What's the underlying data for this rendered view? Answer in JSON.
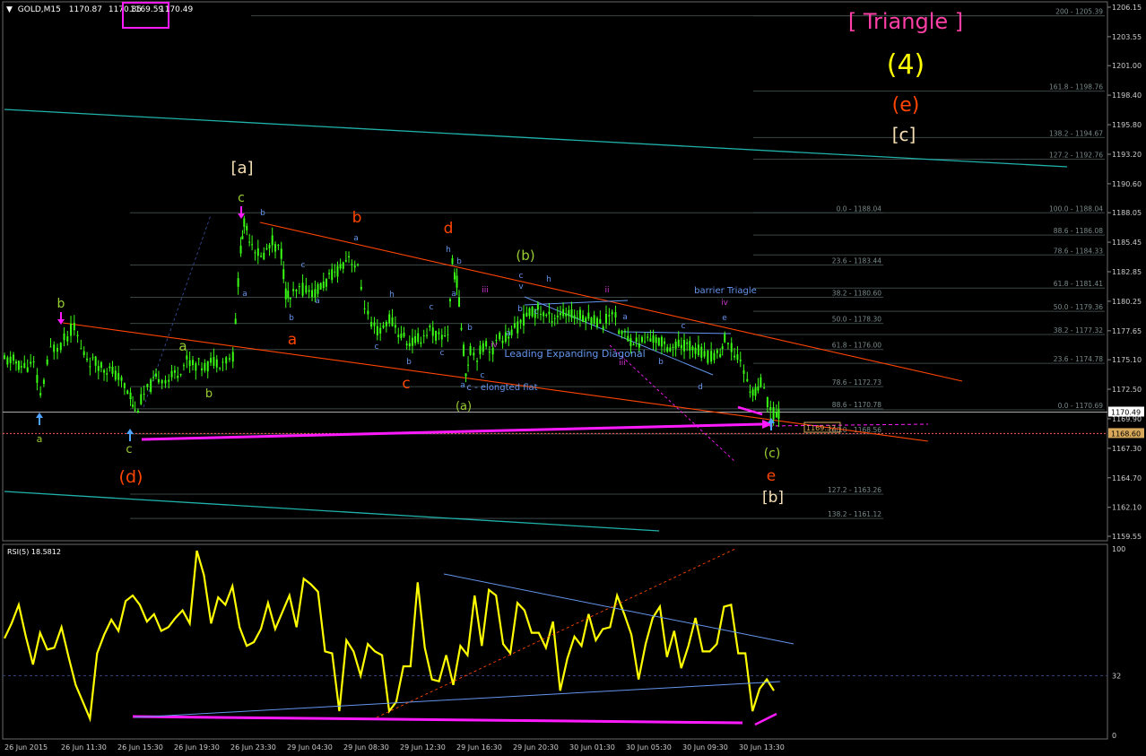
{
  "header": {
    "symbol": "GOLD,M15",
    "open": "1170.87",
    "high": "1170.85",
    "low": "1169.59",
    "close": "1170.49"
  },
  "colors": {
    "background": "#000000",
    "candle": "#39ff14",
    "trendline": "#ff4500",
    "teal": "#20b2aa",
    "magenta": "#ff1aff",
    "rsi": "#ffff00",
    "fib": "#7a8a8a",
    "triangle_title": "#ff3fa6",
    "wave_yellow": "#ffff00",
    "wave_red": "#ff4500",
    "wave_white": "#f5deb3",
    "wave_olive": "#9acd32",
    "wave_blue": "#6495ed",
    "wave_purple": "#cc33cc"
  },
  "chart_data": [
    {
      "type": "candlestick",
      "symbol": "GOLD",
      "timeframe": "M15",
      "ylim": [
        1159.55,
        1206.15
      ],
      "y_ticks": [
        "1206.15",
        "1203.55",
        "1201.00",
        "1198.40",
        "1195.80",
        "1193.20",
        "1190.60",
        "1188.05",
        "1185.45",
        "1182.85",
        "1180.25",
        "1177.65",
        "1175.10",
        "1172.50",
        "1169.90",
        "1167.30",
        "1164.70",
        "1162.10",
        "1159.55"
      ],
      "x_ticks": [
        "26 Jun 2015",
        "26 Jun 11:30",
        "26 Jun 15:30",
        "26 Jun 19:30",
        "26 Jun 23:30",
        "29 Jun 04:30",
        "29 Jun 08:30",
        "29 Jun 12:30",
        "29 Jun 16:30",
        "29 Jun 20:30",
        "30 Jun 01:30",
        "30 Jun 05:30",
        "30 Jun 09:30",
        "30 Jun 13:30"
      ],
      "price_badges": {
        "current": "1170.49",
        "level": "1168.60",
        "marker": "1169.32"
      },
      "price_path": [
        [
          0.0,
          1175.0
        ],
        [
          0.8,
          1175.0
        ],
        [
          1.5,
          1174.5
        ],
        [
          2.6,
          1174.6
        ],
        [
          3.2,
          1172.0
        ],
        [
          4.1,
          1176.0
        ],
        [
          5.0,
          1176.5
        ],
        [
          5.6,
          1177.2
        ],
        [
          6.2,
          1178.2
        ],
        [
          6.8,
          1176.0
        ],
        [
          7.6,
          1175.0
        ],
        [
          8.6,
          1174.6
        ],
        [
          9.6,
          1174.0
        ],
        [
          10.4,
          1173.2
        ],
        [
          11.2,
          1172.0
        ],
        [
          11.6,
          1170.5
        ],
        [
          12.4,
          1172.0
        ],
        [
          13.0,
          1172.8
        ],
        [
          13.7,
          1173.6
        ],
        [
          14.6,
          1173.4
        ],
        [
          15.4,
          1174.0
        ],
        [
          16.2,
          1175.0
        ],
        [
          17.0,
          1174.7
        ],
        [
          17.8,
          1174.5
        ],
        [
          18.6,
          1175.0
        ],
        [
          19.4,
          1175.0
        ],
        [
          20.3,
          1175.4
        ],
        [
          21.0,
          1185.0
        ],
        [
          21.3,
          1187.0
        ],
        [
          22.0,
          1185.5
        ],
        [
          22.8,
          1184.0
        ],
        [
          23.8,
          1185.5
        ],
        [
          24.6,
          1184.5
        ],
        [
          25.0,
          1181.0
        ],
        [
          25.4,
          1180.5
        ],
        [
          26.2,
          1181.2
        ],
        [
          26.8,
          1181.4
        ],
        [
          27.6,
          1181.0
        ],
        [
          28.6,
          1182.0
        ],
        [
          29.6,
          1183.0
        ],
        [
          30.6,
          1184.3
        ],
        [
          31.4,
          1183.0
        ],
        [
          32.0,
          1180.0
        ],
        [
          32.6,
          1178.0
        ],
        [
          33.4,
          1177.5
        ],
        [
          34.2,
          1178.8
        ],
        [
          35.0,
          1177.5
        ],
        [
          36.0,
          1176.5
        ],
        [
          37.0,
          1177.0
        ],
        [
          37.8,
          1177.8
        ],
        [
          38.6,
          1177.0
        ],
        [
          39.4,
          1177.5
        ],
        [
          39.8,
          1183.5
        ],
        [
          40.2,
          1182.0
        ],
        [
          40.6,
          1178.0
        ],
        [
          41.0,
          1174.0
        ],
        [
          41.4,
          1176.0
        ],
        [
          42.0,
          1175.5
        ],
        [
          42.8,
          1176.5
        ],
        [
          43.4,
          1176.0
        ],
        [
          44.0,
          1177.0
        ],
        [
          44.8,
          1177.2
        ],
        [
          45.6,
          1178.0
        ],
        [
          46.4,
          1179.0
        ],
        [
          47.4,
          1179.5
        ],
        [
          48.4,
          1178.8
        ],
        [
          49.4,
          1179.2
        ],
        [
          50.4,
          1179.0
        ],
        [
          51.4,
          1179.0
        ],
        [
          52.4,
          1178.7
        ],
        [
          53.2,
          1178.2
        ],
        [
          54.0,
          1179.6
        ],
        [
          54.6,
          1177.8
        ],
        [
          55.4,
          1177.0
        ],
        [
          56.4,
          1176.6
        ],
        [
          57.4,
          1177.0
        ],
        [
          58.4,
          1176.6
        ],
        [
          59.4,
          1176.2
        ],
        [
          60.4,
          1176.4
        ],
        [
          61.4,
          1176.2
        ],
        [
          62.2,
          1175.5
        ],
        [
          62.8,
          1175.3
        ],
        [
          63.6,
          1175.8
        ],
        [
          64.0,
          1176.8
        ],
        [
          64.6,
          1176.0
        ],
        [
          65.4,
          1175.2
        ],
        [
          66.0,
          1173.0
        ],
        [
          66.5,
          1172.2
        ],
        [
          67.2,
          1173.0
        ],
        [
          67.8,
          1171.4
        ],
        [
          68.6,
          1170.0
        ],
        [
          69.0,
          1170.6
        ]
      ],
      "series_annotations": [
        {
          "label": "[ Triangle ]",
          "color": "triangle_title"
        },
        {
          "label": "(4)",
          "color": "wave_yellow"
        },
        {
          "label": "(e)",
          "color": "wave_red"
        },
        {
          "label": "[c]",
          "color": "wave_white"
        }
      ]
    },
    {
      "type": "line",
      "name": "RSI(5) 18.5812",
      "ylim": [
        0,
        100
      ],
      "y_ticks": [
        "100",
        "32",
        "0"
      ],
      "level": 32,
      "values": [
        52,
        60,
        70,
        53,
        38,
        55,
        46,
        47,
        58,
        42,
        27,
        18,
        9,
        44,
        54,
        62,
        56,
        72,
        75,
        70,
        61,
        65,
        56,
        58,
        63,
        67,
        60,
        99,
        86,
        60,
        74,
        70,
        80,
        58,
        48,
        50,
        57,
        71,
        57,
        66,
        75,
        58,
        84,
        81,
        77,
        45,
        44,
        13,
        51,
        45,
        32,
        49,
        45,
        43,
        13,
        18,
        37,
        37,
        82,
        47,
        30,
        29,
        43,
        27,
        48,
        43,
        75,
        48,
        78,
        75,
        49,
        44,
        71,
        67,
        55,
        55,
        47,
        61,
        24,
        41,
        53,
        48,
        65,
        51,
        57,
        58,
        75,
        65,
        54,
        30,
        49,
        63,
        69,
        42,
        56,
        36,
        48,
        63,
        45,
        45,
        49,
        69,
        70,
        44,
        44,
        13,
        25,
        30,
        24
      ]
    }
  ],
  "fib_labels_left": [
    "0.0 - 1188.04",
    "23.6 - 1183.44",
    "38.2 - 1180.60",
    "50.0 - 1178.30",
    "61.8 - 1176.00",
    "78.6 - 1172.73",
    "88.6 - 1170.78",
    "100.0 - 1168.56",
    "127.2 - 1163.26",
    "138.2 - 1161.12"
  ],
  "fib_labels_right": [
    "200 - 1205.39",
    "161.8 - 1198.76",
    "138.2 - 1194.67",
    "127.2 - 1192.76",
    "100.0 - 1188.04",
    "88.6 - 1186.08",
    "78.6 - 1184.33",
    "61.8 - 1181.41",
    "50.0 - 1179.36",
    "38.2 - 1177.32",
    "23.6 - 1174.78",
    "0.0 - 1170.69"
  ],
  "wave_labels": {
    "a1": "a",
    "b1": "b",
    "c_d": "c",
    "d_paren": "(d)",
    "a_y": "a",
    "b_y": "b",
    "bracket_a": "[a]",
    "c_top": "c",
    "a_red": "a",
    "c_red": "c",
    "b_red": "b",
    "d_red": "d",
    "b_paren": "(b)",
    "a_paren": "(a)",
    "c_paren": "(c)",
    "e_red": "e",
    "bracket_b": "[b]",
    "elongated_flat": "c - elongted flat",
    "leading": "Leading Expanding Diagonal",
    "barrier": "barrier Triagle",
    "small": [
      "b",
      "a",
      "c",
      "a",
      "b",
      "c",
      "h",
      "a",
      "b",
      "c",
      "c",
      "h",
      "a",
      "b",
      "c",
      "a",
      "b",
      "iii",
      "iv",
      "c",
      "v",
      "a",
      "b",
      "c",
      "h",
      "ii",
      "iii",
      "a",
      "b",
      "c",
      "d",
      "e",
      "iv"
    ]
  }
}
